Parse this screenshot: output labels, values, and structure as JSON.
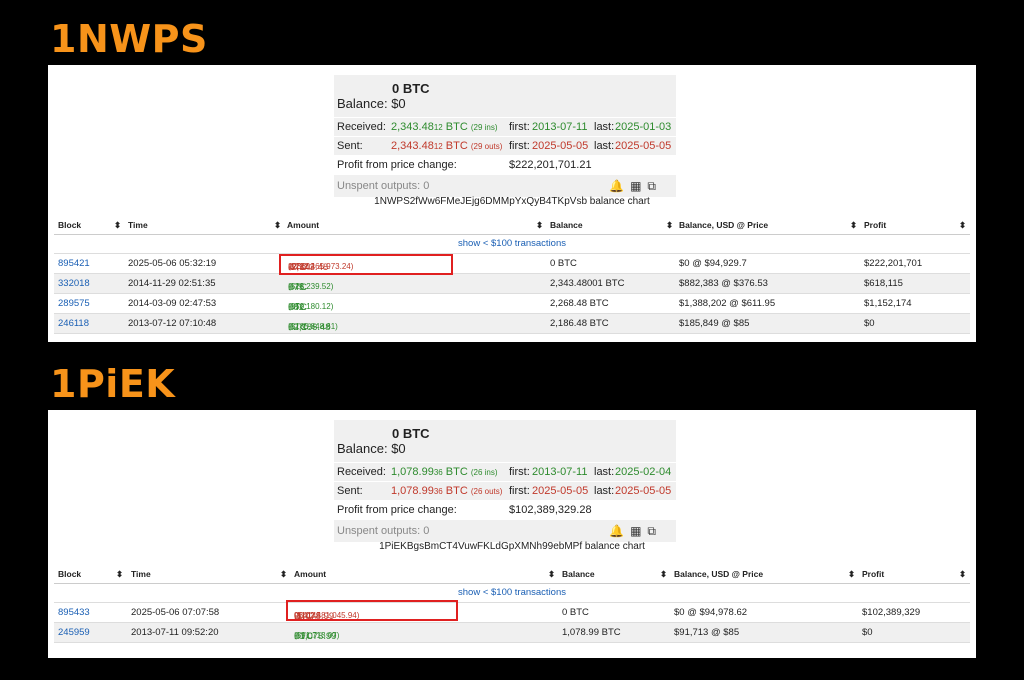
{
  "panels": [
    {
      "heading": "1NWPS",
      "balance_btc": "0 BTC",
      "balance_usd": "Balance: $0",
      "received_label": "Received:",
      "received_main": "2,343.48",
      "received_small": "12",
      "received_unit": " BTC",
      "received_count": "(29 ins)",
      "received_first_label": "first:",
      "received_first": "2013-07-11",
      "received_last_label": "last:",
      "received_last": "2025-01-03",
      "sent_label": "Sent:",
      "sent_main": "2,343.48",
      "sent_small": "12",
      "sent_unit": " BTC",
      "sent_count": "(29 outs)",
      "sent_first_label": "first:",
      "sent_first": "2025-05-05",
      "sent_last_label": "last:",
      "sent_last": "2025-05-05",
      "profit_label": "Profit from price change:",
      "profit_value": "$222,201,701.21",
      "unspent": "Unspent outputs: 0",
      "chart_link": "1NWPS2fWw6FMeJEjg6DMMpYxQyB4TKpVsb balance chart",
      "headers": [
        "Block",
        "Time",
        "Amount",
        "Balance",
        "Balance, USD @ Price",
        "Profit"
      ],
      "show_small": "show < $100 transactions",
      "rows": [
        {
          "block": "895421",
          "time": "2025-05-06 05:32:19",
          "amount_main": "-2,343.48",
          "amount_small": "123602",
          "amount_unit": " BTC",
          "amount_usd": "($222,465,973.24)",
          "balance": "0 BTC",
          "balance_usd": "$0 @ $94,929.7",
          "profit": "$222,201,701"
        },
        {
          "block": "332018",
          "time": "2014-11-29 02:51:35",
          "amount_main": "+75",
          "amount_small": "",
          "amount_unit": " BTC",
          "amount_usd": "($28,239.52)",
          "balance": "2,343.48001 BTC",
          "balance_usd": "$882,383 @ $376.53",
          "profit": "$618,115"
        },
        {
          "block": "289575",
          "time": "2014-03-09 02:47:53",
          "amount_main": "+82",
          "amount_small": "",
          "amount_unit": " BTC",
          "amount_usd": "($50,180.12)",
          "balance": "2,268.48 BTC",
          "balance_usd": "$1,388,202 @ $611.95",
          "profit": "$1,152,174"
        },
        {
          "block": "246118",
          "time": "2013-07-12 07:10:48",
          "amount_main": "+2,186.48",
          "amount_small": "",
          "amount_unit": " BTC",
          "amount_usd": "($185,848.61)",
          "balance": "2,186.48 BTC",
          "balance_usd": "$185,849 @ $85",
          "profit": "$0"
        }
      ]
    },
    {
      "heading": "1PiEK",
      "balance_btc": "0 BTC",
      "balance_usd": "Balance: $0",
      "received_label": "Received:",
      "received_main": "1,078.99",
      "received_small": "36",
      "received_unit": " BTC",
      "received_count": "(26 ins)",
      "received_first_label": "first:",
      "received_first": "2013-07-11",
      "received_last_label": "last:",
      "received_last": "2025-02-04",
      "sent_label": "Sent:",
      "sent_main": "1,078.99",
      "sent_small": "36",
      "sent_unit": " BTC",
      "sent_count": "(26 outs)",
      "sent_first_label": "first:",
      "sent_first": "2025-05-05",
      "sent_last_label": "last:",
      "sent_last": "2025-05-05",
      "profit_label": "Profit from price change:",
      "profit_value": "$102,389,329.28",
      "unspent": "Unspent outputs: 0",
      "chart_link": "1PiEKBgsBmCT4VuwFKLdGpXMNh99ebMPf balance chart",
      "headers": [
        "Block",
        "Time",
        "Amount",
        "Balance",
        "Balance, USD @ Price",
        "Profit"
      ],
      "show_small": "show < $100 transactions",
      "rows": [
        {
          "block": "895433",
          "time": "2025-05-06 07:07:58",
          "amount_main": "-1,078.99",
          "amount_small": "064145",
          "amount_unit": " BTC",
          "amount_usd": "($102,481,045.94)",
          "balance": "0 BTC",
          "balance_usd": "$0 @ $94,978.62",
          "profit": "$102,389,329"
        },
        {
          "block": "245959",
          "time": "2013-07-11 09:52:20",
          "amount_main": "+1,078.99",
          "amount_small": "",
          "amount_unit": " BTC",
          "amount_usd": "($91,713.07)",
          "balance": "1,078.99 BTC",
          "balance_usd": "$91,713 @ $85",
          "profit": "$0"
        }
      ]
    }
  ],
  "colors": {
    "heading": "#f7931a",
    "received": "#2e8b2e",
    "sent": "#c0392b",
    "link": "#1a5fb4",
    "highlight": "#e02020"
  },
  "icons": [
    "bell-icon",
    "qr-code-icon",
    "copy-icon"
  ]
}
